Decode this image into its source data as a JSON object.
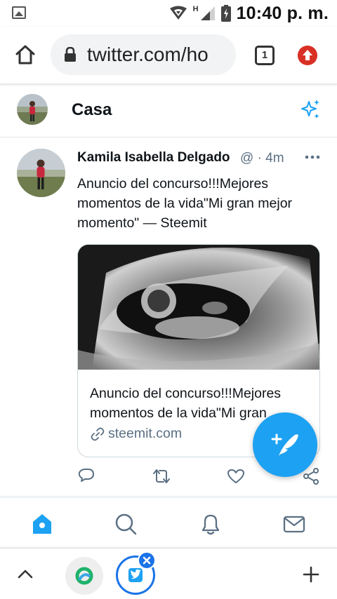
{
  "status_bar": {
    "time": "10:40 p. m.",
    "network_label": "H",
    "icons": [
      "image-notification-icon",
      "vpn-icon",
      "signal-icon",
      "battery-icon"
    ]
  },
  "browser": {
    "url": "twitter.com/ho",
    "tab_count": "1",
    "icons": [
      "home-icon",
      "lock-icon",
      "tab-switcher-icon",
      "update-icon"
    ]
  },
  "header": {
    "title": "Casa",
    "icons": [
      "avatar",
      "sparkle-icon"
    ]
  },
  "tweet": {
    "author": "Kamila Isabella Delgado",
    "handle_time": "@ · 4m",
    "text": "Anuncio del concurso!!!Mejores momentos de la vida\"Mi gran mejor momento\" — Steemit",
    "card": {
      "title": "Anuncio del concurso!!!Mejores momentos de la vida\"Mi gran",
      "domain": "steemit.com"
    },
    "action_icons": [
      "reply-icon",
      "retweet-icon",
      "like-icon",
      "share-icon"
    ]
  },
  "bottom_nav": {
    "items": [
      "home-icon",
      "search-icon",
      "notifications-icon",
      "messages-icon"
    ]
  },
  "colors": {
    "twitter_blue": "#1da1f2",
    "muted_text": "#5b7083",
    "chrome_blue": "#1a73e8",
    "update_red": "#d93025"
  }
}
